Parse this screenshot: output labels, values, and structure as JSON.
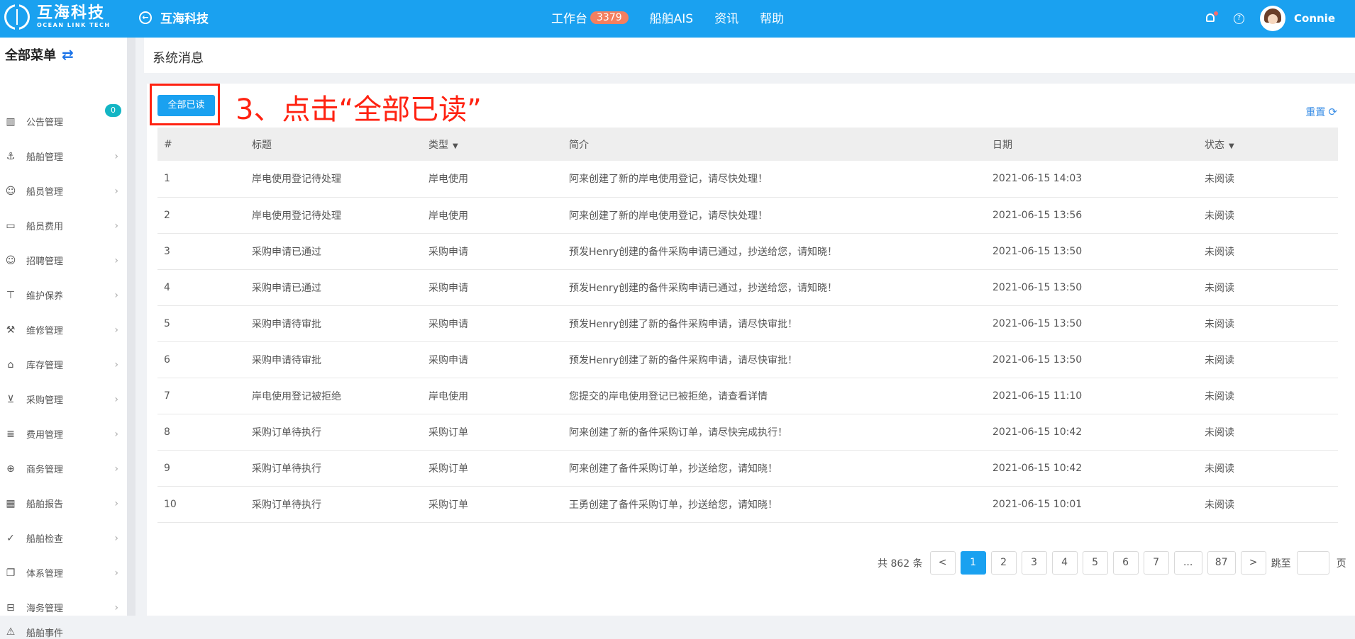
{
  "topbar": {
    "logo_cn": "互海科技",
    "logo_en": "OCEAN LINK TECH",
    "back_title": "互海科技",
    "nav": [
      {
        "label": "工作台",
        "badge": "3379"
      },
      {
        "label": "船舶AIS"
      },
      {
        "label": "资讯"
      },
      {
        "label": "帮助"
      }
    ],
    "username": "Connie"
  },
  "sidebar": {
    "title": "全部菜单",
    "items": [
      {
        "label": "公告管理",
        "icon": "book-icon",
        "badge": "0"
      },
      {
        "label": "船舶管理",
        "icon": "anchor-icon"
      },
      {
        "label": "船员管理",
        "icon": "user-icon"
      },
      {
        "label": "船员费用",
        "icon": "wallet-icon"
      },
      {
        "label": "招聘管理",
        "icon": "recruit-icon"
      },
      {
        "label": "维护保养",
        "icon": "hammer-icon"
      },
      {
        "label": "维修管理",
        "icon": "wrench-icon"
      },
      {
        "label": "库存管理",
        "icon": "warehouse-icon"
      },
      {
        "label": "采购管理",
        "icon": "cart-icon"
      },
      {
        "label": "费用管理",
        "icon": "coins-icon"
      },
      {
        "label": "商务管理",
        "icon": "globe-icon"
      },
      {
        "label": "船舶报告",
        "icon": "calendar-icon"
      },
      {
        "label": "船舶检查",
        "icon": "check-circle-icon"
      },
      {
        "label": "体系管理",
        "icon": "docs-icon"
      },
      {
        "label": "海务管理",
        "icon": "signpost-icon"
      },
      {
        "label": "船舶事件",
        "icon": "warning-icon"
      }
    ]
  },
  "page": {
    "title": "系统消息",
    "read_all_label": "全部已读",
    "annotation": "3、点击“全部已读”",
    "reset_label": "重置"
  },
  "table": {
    "columns": [
      "#",
      "标题",
      "类型",
      "简介",
      "日期",
      "状态"
    ],
    "rows": [
      [
        "1",
        "岸电使用登记待处理",
        "岸电使用",
        "阿来创建了新的岸电使用登记，请尽快处理！",
        "2021-06-15 14:03",
        "未阅读"
      ],
      [
        "2",
        "岸电使用登记待处理",
        "岸电使用",
        "阿来创建了新的岸电使用登记，请尽快处理！",
        "2021-06-15 13:56",
        "未阅读"
      ],
      [
        "3",
        "采购申请已通过",
        "采购申请",
        "预发Henry创建的备件采购申请已通过，抄送给您，请知晓！",
        "2021-06-15 13:50",
        "未阅读"
      ],
      [
        "4",
        "采购申请已通过",
        "采购申请",
        "预发Henry创建的备件采购申请已通过，抄送给您，请知晓！",
        "2021-06-15 13:50",
        "未阅读"
      ],
      [
        "5",
        "采购申请待审批",
        "采购申请",
        "预发Henry创建了新的备件采购申请，请尽快审批！",
        "2021-06-15 13:50",
        "未阅读"
      ],
      [
        "6",
        "采购申请待审批",
        "采购申请",
        "预发Henry创建了新的备件采购申请，请尽快审批！",
        "2021-06-15 13:50",
        "未阅读"
      ],
      [
        "7",
        "岸电使用登记被拒绝",
        "岸电使用",
        "您提交的岸电使用登记已被拒绝，请查看详情",
        "2021-06-15 11:10",
        "未阅读"
      ],
      [
        "8",
        "采购订单待执行",
        "采购订单",
        "阿来创建了新的备件采购订单，请尽快完成执行！",
        "2021-06-15 10:42",
        "未阅读"
      ],
      [
        "9",
        "采购订单待执行",
        "采购订单",
        "阿来创建了备件采购订单，抄送给您，请知晓！",
        "2021-06-15 10:42",
        "未阅读"
      ],
      [
        "10",
        "采购订单待执行",
        "采购订单",
        "王勇创建了备件采购订单，抄送给您，请知晓！",
        "2021-06-15 10:01",
        "未阅读"
      ]
    ]
  },
  "pagination": {
    "total": "共 862 条",
    "prev": "<",
    "next": ">",
    "pages": [
      "1",
      "2",
      "3",
      "4",
      "5",
      "6",
      "7",
      "...",
      "87"
    ],
    "active_page": "1",
    "jump_label": "跳至",
    "page_suffix": "页"
  }
}
